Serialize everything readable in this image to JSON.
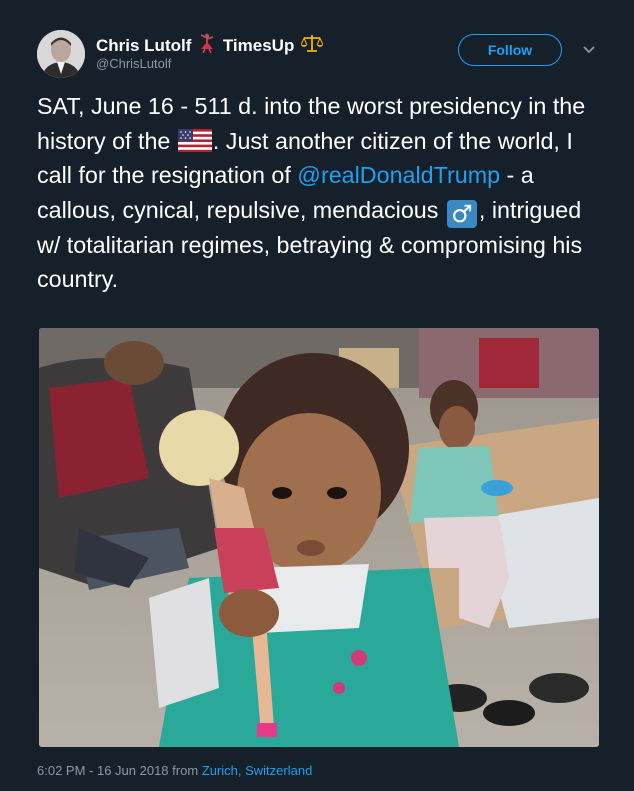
{
  "author": {
    "display_name": "Chris Lutolf",
    "name_suffix": "TimesUp",
    "emoji_1": "dancer-emoji",
    "emoji_2": "scales-emoji",
    "handle": "@ChrisLutolf"
  },
  "follow": {
    "label": "Follow"
  },
  "tweet": {
    "segment_1": "SAT, June 16 - 511 d. into the worst presidency in the history of the ",
    "flag": "us-flag-emoji",
    "segment_2": ". Just another citizen of the world, I call for the resignation of ",
    "mention": "@realDonaldTrump",
    "segment_3": " - a callous, cynical, repulsive, mendacious ",
    "male_sign": "♂",
    "segment_4": ", intrigued w/ totalitarian regimes, betraying & compromising his country."
  },
  "timestamp": {
    "time": "6:02 PM - 16 Jun 2018 from ",
    "location": "Zurich, Switzerland"
  },
  "colors": {
    "background": "#15202b",
    "accent": "#1da1f2",
    "secondary_text": "#8899a6"
  }
}
